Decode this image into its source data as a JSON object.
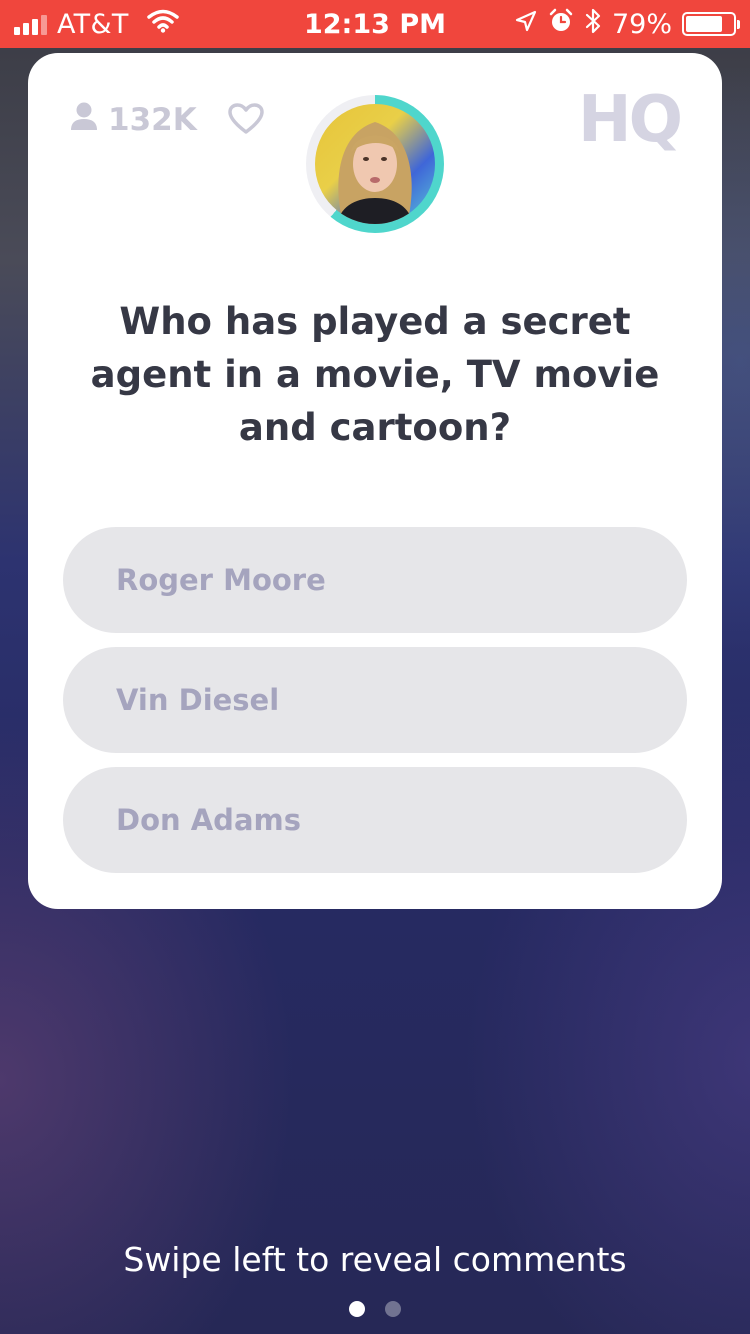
{
  "status_bar": {
    "carrier": "AT&T",
    "time": "12:13 PM",
    "battery_percent": "79%",
    "battery_level": 0.79,
    "signal_bars_filled": 3,
    "icons": [
      "signal-icon",
      "wifi-icon",
      "location-arrow-icon",
      "alarm-icon",
      "bluetooth-icon",
      "battery-icon"
    ],
    "color": "#f0463d"
  },
  "card": {
    "viewer_count": "132K",
    "logo": "HQ",
    "icons": [
      "person-icon",
      "heart-icon"
    ],
    "host_timer_color": "#4fd6cc",
    "question": "Who has played a secret agent in a movie, TV movie and cartoon?",
    "answers": [
      {
        "label": "Roger Moore"
      },
      {
        "label": "Vin Diesel"
      },
      {
        "label": "Don Adams"
      }
    ]
  },
  "footer": {
    "swipe_hint": "Swipe left to reveal comments",
    "page_count": 2,
    "active_page": 1
  }
}
